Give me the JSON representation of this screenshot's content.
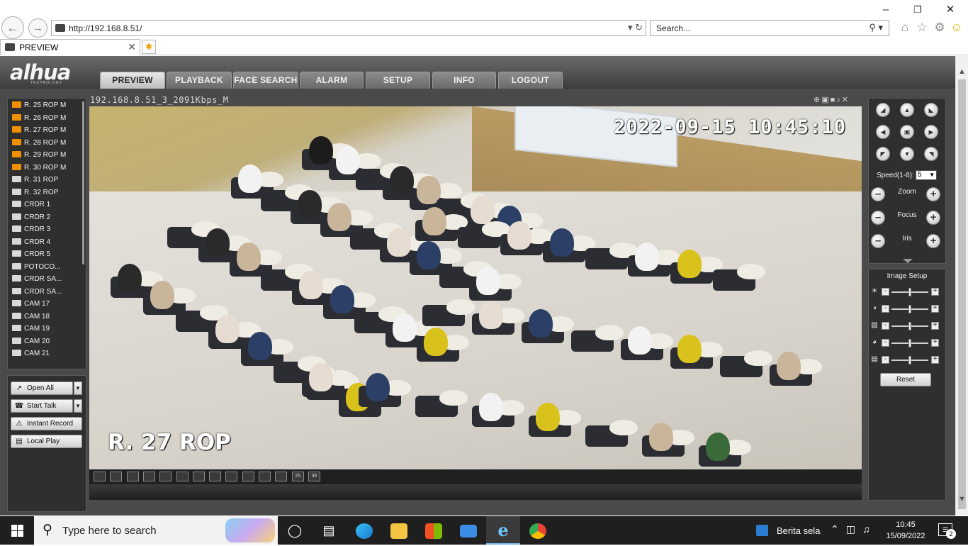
{
  "browser": {
    "url": "http://192.168.8.51/",
    "search_placeholder": "Search...",
    "tab_title": "PREVIEW",
    "back_icon": "back-arrow-icon",
    "forward_icon": "forward-arrow-icon"
  },
  "app": {
    "logo": "alhua",
    "logo_sub": "TECHNOLOGY",
    "nav_tabs": [
      "PREVIEW",
      "PLAYBACK",
      "FACE SEARCH",
      "ALARM",
      "SETUP",
      "INFO",
      "LOGOUT"
    ],
    "active_tab": "PREVIEW",
    "cameras": [
      {
        "label": "R. 25 ROP   M",
        "active": true
      },
      {
        "label": "R. 26 ROP   M",
        "active": true
      },
      {
        "label": "R. 27 ROP   M",
        "active": true
      },
      {
        "label": "R. 28 ROP   M",
        "active": true
      },
      {
        "label": "R. 29 ROP   M",
        "active": true
      },
      {
        "label": "R. 30 ROP   M",
        "active": true
      },
      {
        "label": "R. 31 ROP",
        "active": false
      },
      {
        "label": "R. 32 ROP",
        "active": false
      },
      {
        "label": "CRDR 1",
        "active": false
      },
      {
        "label": "CRDR 2",
        "active": false
      },
      {
        "label": "CRDR 3",
        "active": false
      },
      {
        "label": "CRDR 4",
        "active": false
      },
      {
        "label": "CRDR 5",
        "active": false
      },
      {
        "label": "POTOCO...",
        "active": false
      },
      {
        "label": "CRDR SA...",
        "active": false
      },
      {
        "label": "CRDR SA...",
        "active": false
      },
      {
        "label": "CAM 17",
        "active": false
      },
      {
        "label": "CAM 18",
        "active": false
      },
      {
        "label": "CAM 19",
        "active": false
      },
      {
        "label": "CAM 20",
        "active": false
      },
      {
        "label": "CAM 21",
        "active": false
      }
    ],
    "controls": {
      "open_all": "Open All",
      "start_talk": "Start Talk",
      "instant_record": "Instant Record",
      "local_play": "Local Play"
    },
    "video": {
      "title": "192.168.8.51_3_2091Kbps_M",
      "osd_datetime": "2022-09-15 10:45:10",
      "osd_channel": "R. 27 ROP"
    },
    "layout_buttons": [
      "",
      "",
      "",
      "",
      "",
      "",
      "",
      "",
      "",
      "",
      "",
      "",
      "25",
      "36"
    ],
    "ptz": {
      "speed_label": "Speed(1-8):",
      "speed_value": "5",
      "zoom": "Zoom",
      "focus": "Focus",
      "iris": "Iris"
    },
    "image_setup": {
      "title": "Image Setup",
      "reset": "Reset",
      "rows": [
        {
          "icon": "brightness-icon",
          "level": 0.5
        },
        {
          "icon": "contrast-icon",
          "level": 0.5
        },
        {
          "icon": "saturation-icon",
          "level": 0.5
        },
        {
          "icon": "hue-icon",
          "level": 0.5
        },
        {
          "icon": "sharpness-icon",
          "level": 0.5
        }
      ]
    }
  },
  "taskbar": {
    "search_placeholder": "Type here to search",
    "news_label": "Berita sela",
    "time": "10:45",
    "date": "15/09/2022",
    "notifications": "2"
  }
}
